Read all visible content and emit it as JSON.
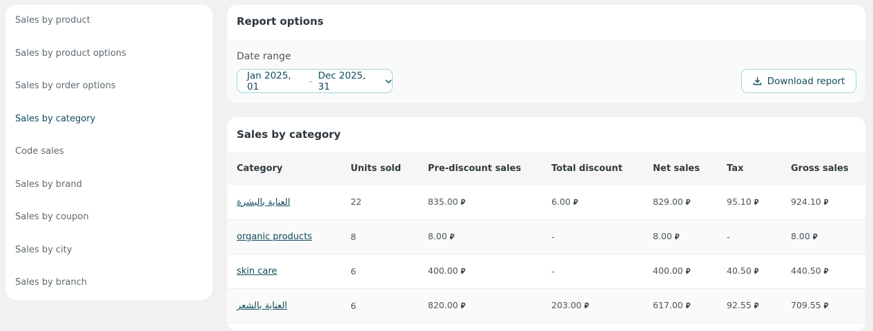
{
  "sidebar": {
    "items": [
      {
        "label": "Sales by product"
      },
      {
        "label": "Sales by product options"
      },
      {
        "label": "Sales by order options"
      },
      {
        "label": "Sales by category"
      },
      {
        "label": "Code sales"
      },
      {
        "label": "Sales by brand"
      },
      {
        "label": "Sales by coupon"
      },
      {
        "label": "Sales by city"
      },
      {
        "label": "Sales by branch"
      }
    ],
    "active_index": 3
  },
  "report_options": {
    "title": "Report options",
    "date_label": "Date range",
    "date_start": "Jan 2025, 01",
    "date_separator": "-",
    "date_end": "Dec 2025, 31",
    "download_label": "Download report"
  },
  "table": {
    "title": "Sales by category",
    "headers": [
      "Category",
      "Units sold",
      "Pre-discount sales",
      "Total discount",
      "Net sales",
      "Tax",
      "Gross sales"
    ],
    "currency_icon": "saudi-riyal-icon",
    "rows": [
      {
        "category": "العناية بالبشرة",
        "units": "22",
        "pre": "835.00",
        "discount": "6.00",
        "net": "829.00",
        "tax": "95.10",
        "gross": "924.10"
      },
      {
        "category": "organic products",
        "units": "8",
        "pre": "8.00",
        "discount": "-",
        "net": "8.00",
        "tax": "-",
        "gross": "8.00"
      },
      {
        "category": "skin care",
        "units": "6",
        "pre": "400.00",
        "discount": "-",
        "net": "400.00",
        "tax": "40.50",
        "gross": "440.50"
      },
      {
        "category": "العناية بالشعر",
        "units": "6",
        "pre": "820.00",
        "discount": "203.00",
        "net": "617.00",
        "tax": "92.55",
        "gross": "709.55"
      }
    ]
  },
  "colors": {
    "accent": "#0e4b5b",
    "border_accent": "#9ed9d3",
    "background": "#f1f1f1"
  }
}
